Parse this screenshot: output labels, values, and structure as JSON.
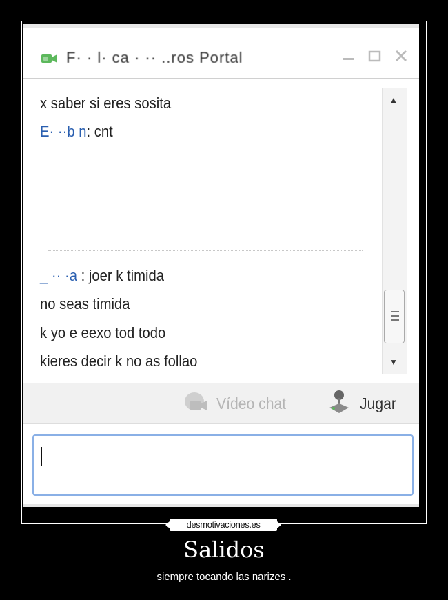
{
  "chat": {
    "title": "F·  ·  l·  ca  ·  ··   ..ros Portal",
    "messages": [
      {
        "who": "",
        "text": "x saber si eres sosita"
      },
      {
        "who": "E·  ··b  n",
        "text": ": cnt"
      },
      {
        "who": "_  ··  ·a",
        "text": " : joer k timida"
      },
      {
        "who": "",
        "text": "no seas timida"
      },
      {
        "who": "",
        "text": "k yo e eexo tod todo"
      },
      {
        "who": "",
        "text": "kieres decir k no as  follao"
      }
    ],
    "toolbar": {
      "video_label": "Vídeo chat",
      "game_label": "Jugar"
    },
    "input_value": ""
  },
  "watermark": "desmotivaciones.es",
  "caption": {
    "title": "Salidos",
    "subtitle": "siempre tocando las narizes ."
  },
  "colors": {
    "background": "#000000",
    "accent_green": "#5cb85c",
    "sender_blue": "#2a5fb0",
    "input_border": "#8ab0e6"
  },
  "icons": [
    "video-camera-icon",
    "minimize-icon",
    "maximize-icon",
    "close-icon",
    "scroll-up-icon",
    "scroll-down-icon",
    "video-chat-icon",
    "joystick-icon"
  ]
}
